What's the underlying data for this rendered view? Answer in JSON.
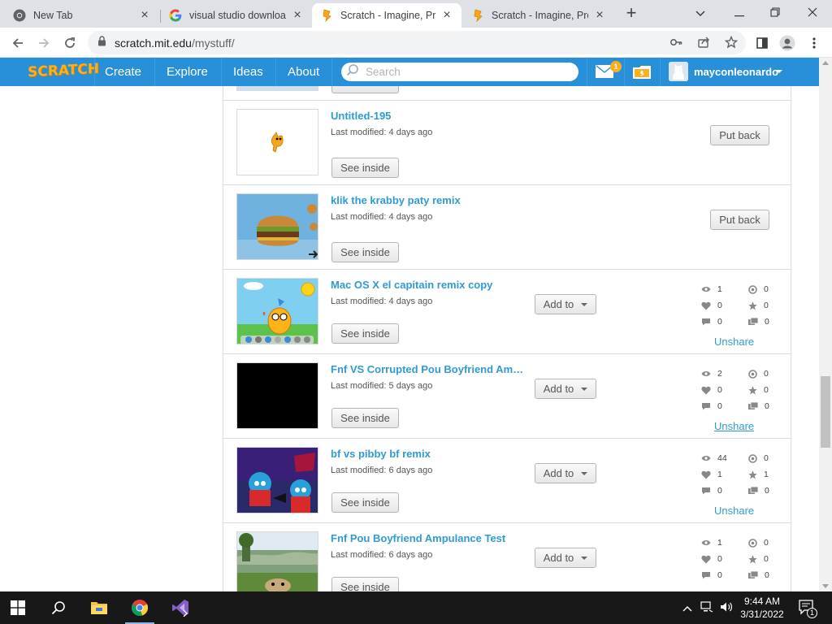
{
  "browser": {
    "tabs": [
      {
        "title": "New Tab"
      },
      {
        "title": "visual studio download"
      },
      {
        "title": "Scratch - Imagine, Program"
      },
      {
        "title": "Scratch - Imagine, Program"
      }
    ],
    "url_host": "scratch.mit.edu",
    "url_path": "/mystuff/"
  },
  "scratch_nav": {
    "logo": "SCRATCH",
    "links": [
      "Create",
      "Explore",
      "Ideas",
      "About"
    ],
    "search_placeholder": "Search",
    "message_count": "1",
    "username": "mayconleonardo"
  },
  "projects": [
    {
      "title": "Untitled-195",
      "modified": "Last modified: 4 days ago",
      "see_inside": "See inside",
      "action": "Put back"
    },
    {
      "title": "klik the krabby paty remix",
      "modified": "Last modified: 4 days ago",
      "see_inside": "See inside",
      "action": "Put back"
    },
    {
      "title": "Mac OS X el capitain remix copy",
      "modified": "Last modified: 4 days ago",
      "see_inside": "See inside",
      "add_to": "Add to",
      "views": "1",
      "remixes": "0",
      "loves": "0",
      "favorites": "0",
      "comments": "0",
      "studios": "0",
      "unshare": "Unshare"
    },
    {
      "title": "Fnf VS Corrupted Pou Boyfriend Am…",
      "modified": "Last modified: 5 days ago",
      "see_inside": "See inside",
      "add_to": "Add to",
      "views": "2",
      "remixes": "0",
      "loves": "0",
      "favorites": "0",
      "comments": "0",
      "studios": "0",
      "unshare": "Unshare"
    },
    {
      "title": "bf vs pibby bf remix",
      "modified": "Last modified: 6 days ago",
      "see_inside": "See inside",
      "add_to": "Add to",
      "views": "44",
      "remixes": "0",
      "loves": "1",
      "favorites": "1",
      "comments": "0",
      "studios": "0",
      "unshare": "Unshare"
    },
    {
      "title": "Fnf Pou Boyfriend Ampulance Test",
      "modified": "Last modified: 6 days ago",
      "see_inside": "See inside",
      "add_to": "Add to",
      "views": "1",
      "remixes": "0",
      "loves": "0",
      "favorites": "0",
      "comments": "0",
      "studios": "0"
    }
  ],
  "taskbar": {
    "time": "9:44 AM",
    "date": "3/31/2022",
    "notification_count": "1"
  },
  "colors": {
    "scratch_blue": "#2790d8",
    "link_blue": "#2f9bd0",
    "taskbar": "#181818"
  }
}
